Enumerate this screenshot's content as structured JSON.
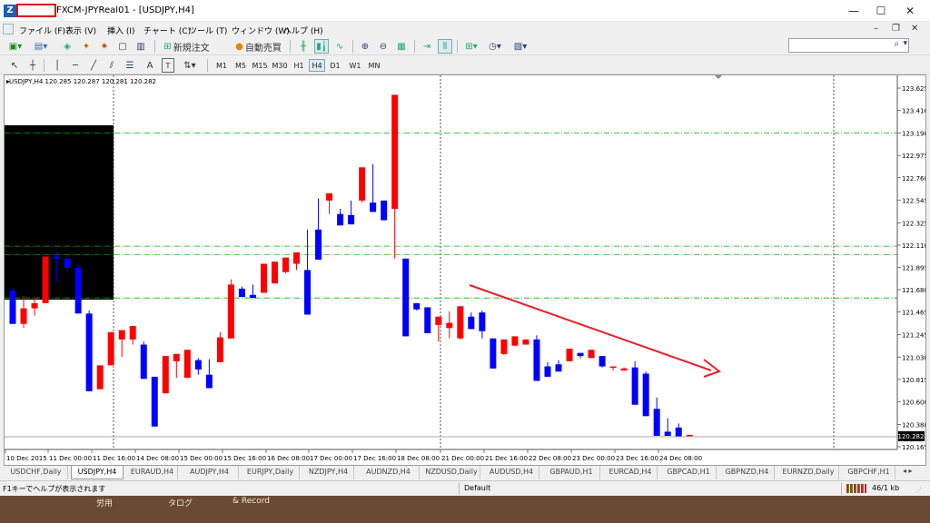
{
  "window": {
    "title": "FXCM-JPYReal01 - [USDJPY,H4]",
    "controls": [
      "—",
      "☐",
      "✕"
    ]
  },
  "menu": [
    "ファイル (F)",
    "表示 (V)",
    "挿入 (I)",
    "チャート (C)",
    "ツール (T)",
    "ウィンドウ (W)",
    "ヘルプ (H)"
  ],
  "toolbar": {
    "new_order": "新規注文",
    "auto_trading": "自動売買",
    "text_tool": "A",
    "label_tool": "T",
    "timeframes": [
      "M1",
      "M5",
      "M15",
      "M30",
      "H1",
      "H4",
      "D1",
      "W1",
      "MN"
    ],
    "active_timeframe": "H4"
  },
  "chart": {
    "header": "USDJPY,H4  120.285 120.287 120.281 120.282",
    "current_price": "120.282",
    "colors": {
      "bull": "#ff0000",
      "bear": "#0000ff",
      "level": "#00b400",
      "arrow": "#e8202a"
    },
    "chart_data": {
      "type": "candlestick",
      "symbol": "USDJPY",
      "timeframe": "H4",
      "ylim": [
        120.165,
        123.625
      ],
      "y_ticks": [
        "123.625",
        "123.410",
        "123.190",
        "122.975",
        "122.760",
        "122.545",
        "122.325",
        "122.110",
        "121.895",
        "121.680",
        "121.465",
        "121.245",
        "121.030",
        "120.815",
        "120.600",
        "120.380",
        "120.165"
      ],
      "x_ticks": [
        "10 Dec 2015",
        "11 Dec 00:00",
        "11 Dec 16:00",
        "14 Dec 08:00",
        "15 Dec 00:00",
        "15 Dec 16:00",
        "16 Dec 08:00",
        "17 Dec 00:00",
        "17 Dec 16:00",
        "18 Dec 08:00",
        "21 Dec 00:00",
        "21 Dec 16:00",
        "22 Dec 08:00",
        "23 Dec 00:00",
        "23 Dec 16:00",
        "24 Dec 08:00"
      ],
      "horizontal_levels": [
        123.19,
        122.1,
        122.02,
        121.6
      ],
      "candles": [
        [
          121.67,
          121.7,
          121.36,
          121.35
        ],
        [
          121.35,
          121.62,
          121.31,
          121.5
        ],
        [
          121.5,
          121.61,
          121.43,
          121.55
        ],
        [
          121.55,
          121.79,
          121.56,
          122.0
        ],
        [
          122.0,
          122.05,
          121.75,
          121.98
        ],
        [
          121.98,
          122.0,
          121.85,
          121.89
        ],
        [
          121.89,
          121.92,
          121.57,
          121.45
        ],
        [
          121.45,
          121.48,
          120.79,
          120.7
        ],
        [
          120.72,
          120.88,
          120.77,
          120.95
        ],
        [
          120.95,
          121.2,
          120.95,
          121.27
        ],
        [
          121.2,
          121.26,
          121.03,
          121.29
        ],
        [
          121.2,
          121.27,
          121.15,
          121.33
        ],
        [
          121.15,
          121.18,
          120.84,
          120.82
        ],
        [
          120.84,
          120.82,
          120.68,
          120.36
        ],
        [
          120.68,
          120.96,
          120.99,
          121.04
        ],
        [
          120.99,
          121.04,
          120.83,
          121.06
        ],
        [
          120.83,
          120.94,
          121.0,
          121.1
        ],
        [
          121.0,
          121.02,
          120.86,
          120.91
        ],
        [
          120.86,
          121.01,
          120.98,
          120.73
        ],
        [
          120.98,
          121.27,
          121.21,
          121.22
        ],
        [
          121.21,
          121.78,
          121.69,
          121.73
        ],
        [
          121.69,
          121.71,
          121.63,
          121.61
        ],
        [
          121.63,
          121.73,
          121.65,
          121.6
        ],
        [
          121.65,
          121.86,
          121.74,
          121.93
        ],
        [
          121.74,
          121.91,
          121.85,
          121.95
        ],
        [
          121.85,
          121.84,
          121.93,
          121.99
        ],
        [
          121.93,
          121.93,
          121.87,
          122.04
        ],
        [
          121.87,
          121.91,
          122.26,
          121.44
        ],
        [
          122.26,
          122.56,
          122.54,
          121.97
        ],
        [
          122.54,
          122.5,
          122.41,
          122.61
        ],
        [
          122.41,
          122.46,
          122.4,
          122.3
        ],
        [
          122.4,
          122.51,
          122.54,
          122.31
        ],
        [
          122.54,
          122.58,
          122.52,
          122.86
        ],
        [
          122.52,
          122.89,
          122.54,
          122.43
        ],
        [
          122.54,
          122.47,
          122.46,
          122.35
        ],
        [
          122.46,
          122.44,
          121.98,
          123.56
        ],
        [
          121.98,
          121.86,
          121.55,
          121.23
        ],
        [
          121.55,
          121.48,
          121.51,
          121.49
        ],
        [
          121.51,
          121.43,
          121.34,
          121.26
        ],
        [
          121.34,
          121.18,
          121.31,
          121.42
        ],
        [
          121.31,
          121.47,
          121.21,
          121.36
        ],
        [
          121.21,
          121.2,
          121.42,
          121.52
        ],
        [
          121.42,
          121.45,
          121.46,
          121.3
        ],
        [
          121.46,
          121.48,
          121.21,
          121.28
        ],
        [
          121.21,
          121.16,
          121.06,
          120.92
        ],
        [
          121.06,
          121.05,
          121.14,
          121.2
        ],
        [
          121.14,
          121.18,
          121.15,
          121.23
        ],
        [
          121.15,
          121.18,
          121.2,
          121.2
        ],
        [
          121.2,
          121.24,
          120.94,
          120.8
        ],
        [
          120.94,
          120.98,
          120.96,
          120.84
        ],
        [
          120.96,
          121.0,
          120.99,
          120.89
        ],
        [
          120.99,
          121.08,
          121.07,
          121.11
        ],
        [
          121.07,
          121.04,
          121.02,
          121.04
        ],
        [
          121.02,
          121.03,
          121.04,
          121.1
        ],
        [
          121.04,
          121.02,
          120.93,
          120.94
        ],
        [
          120.93,
          120.92,
          120.9,
          120.94
        ],
        [
          120.9,
          120.92,
          120.93,
          120.92
        ],
        [
          120.93,
          120.99,
          120.87,
          120.57
        ],
        [
          120.87,
          120.89,
          120.53,
          120.46
        ],
        [
          120.53,
          120.64,
          120.31,
          120.27
        ],
        [
          120.31,
          120.44,
          120.35,
          120.27
        ],
        [
          120.35,
          120.39,
          120.28,
          120.26
        ],
        [
          120.28,
          120.28,
          120.28,
          120.28
        ]
      ]
    }
  },
  "symbol_tabs": [
    "USDCHF,Daily",
    "USDJPY,H4",
    "EURAUD,H4",
    "AUDJPY,H4",
    "EURJPY,Daily",
    "NZDJPY,H4",
    "AUDNZD,H4",
    "NZDUSD,Daily",
    "AUDUSD,H4",
    "GBPAUD,H1",
    "EURCAD,H4",
    "GBPCAD,H1",
    "GBPNZD,H4",
    "EURNZD,Daily",
    "GBPCHF,H1"
  ],
  "active_tab": "USDJPY,H4",
  "status": {
    "help": "F1キーでヘルプが表示されます",
    "profile": "Default",
    "traffic": "46/1 kb"
  },
  "desktop": [
    "労用",
    "タログ",
    "& Record"
  ]
}
